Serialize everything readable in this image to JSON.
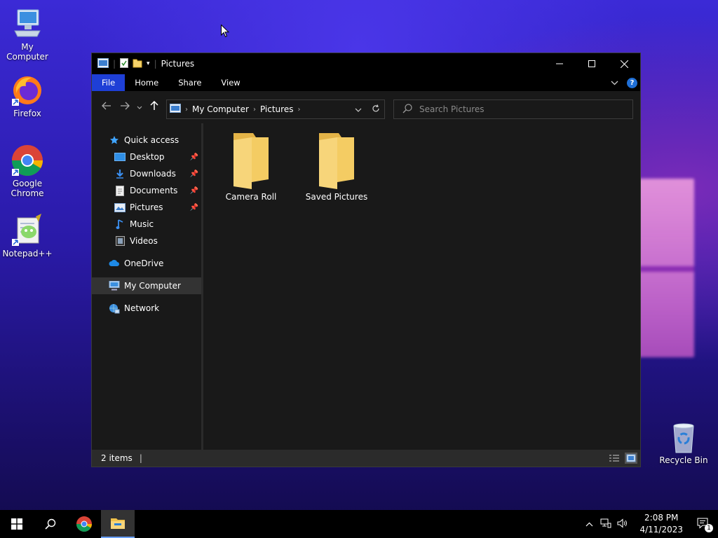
{
  "desktop": {
    "icons": [
      {
        "label": "My Computer",
        "icon": "computer-icon"
      },
      {
        "label": "Firefox",
        "icon": "firefox-icon"
      },
      {
        "label": "Google Chrome",
        "icon": "chrome-icon"
      },
      {
        "label": "Notepad++",
        "icon": "notepadpp-icon"
      },
      {
        "label": "Recycle Bin",
        "icon": "recycle-bin-icon"
      }
    ]
  },
  "window": {
    "title": "Pictures",
    "ribbon": {
      "tabs": [
        "File",
        "Home",
        "Share",
        "View"
      ],
      "accent": "#1e3fd6"
    },
    "address": {
      "crumbs": [
        "My Computer",
        "Pictures"
      ]
    },
    "search": {
      "placeholder": "Search Pictures"
    },
    "sidebar": {
      "quick_access": "Quick access",
      "items": [
        {
          "label": "Desktop",
          "pinned": true
        },
        {
          "label": "Downloads",
          "pinned": true
        },
        {
          "label": "Documents",
          "pinned": true
        },
        {
          "label": "Pictures",
          "pinned": true
        },
        {
          "label": "Music",
          "pinned": false
        },
        {
          "label": "Videos",
          "pinned": false
        }
      ],
      "onedrive": "OneDrive",
      "my_computer": "My Computer",
      "network": "Network"
    },
    "folders": [
      {
        "label": "Camera Roll"
      },
      {
        "label": "Saved Pictures"
      }
    ],
    "status": {
      "items": "2 items"
    }
  },
  "taskbar": {
    "time": "2:08 PM",
    "date": "4/11/2023",
    "notifications": "1"
  }
}
